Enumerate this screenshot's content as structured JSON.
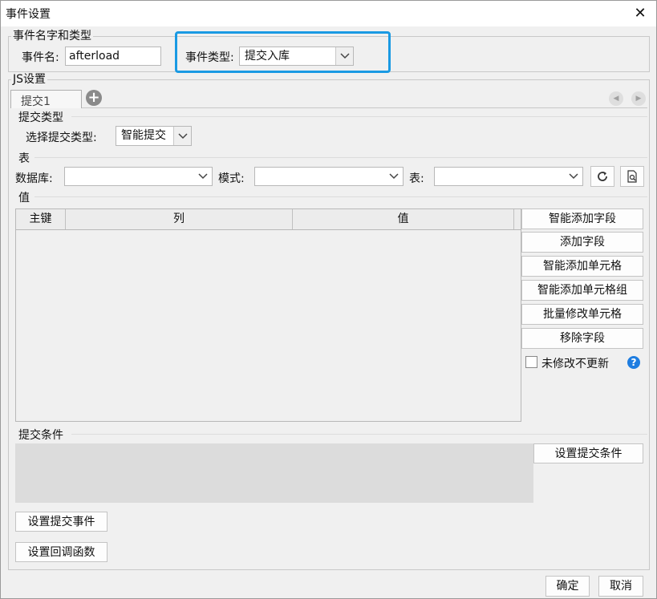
{
  "window": {
    "title": "事件设置"
  },
  "event_group": {
    "title": "事件名字和类型",
    "name_label": "事件名:",
    "name_value": "afterload",
    "type_label": "事件类型:",
    "type_value": "提交入库"
  },
  "js_group": {
    "title": "JS设置",
    "tabs": [
      {
        "label": "提交1"
      }
    ],
    "submit_type": {
      "section": "提交类型",
      "label": "选择提交类型:",
      "value": "智能提交"
    },
    "table_section": {
      "section": "表",
      "db_label": "数据库:",
      "db_value": "",
      "schema_label": "模式:",
      "schema_value": "",
      "table_label": "表:",
      "table_value": ""
    },
    "values": {
      "section": "值",
      "columns": [
        "主键",
        "列",
        "值"
      ],
      "rows": [],
      "buttons": [
        "智能添加字段",
        "添加字段",
        "智能添加单元格",
        "智能添加单元格组",
        "批量修改单元格",
        "移除字段"
      ],
      "checkbox_label": "未修改不更新",
      "checkbox_checked": false
    },
    "condition": {
      "section": "提交条件",
      "button": "设置提交条件"
    },
    "event_buttons": {
      "submit_event": "设置提交事件",
      "callback": "设置回调函数"
    }
  },
  "footer": {
    "ok": "确定",
    "cancel": "取消"
  },
  "colors": {
    "highlight": "#1a9ae3",
    "help": "#1e7de0"
  }
}
